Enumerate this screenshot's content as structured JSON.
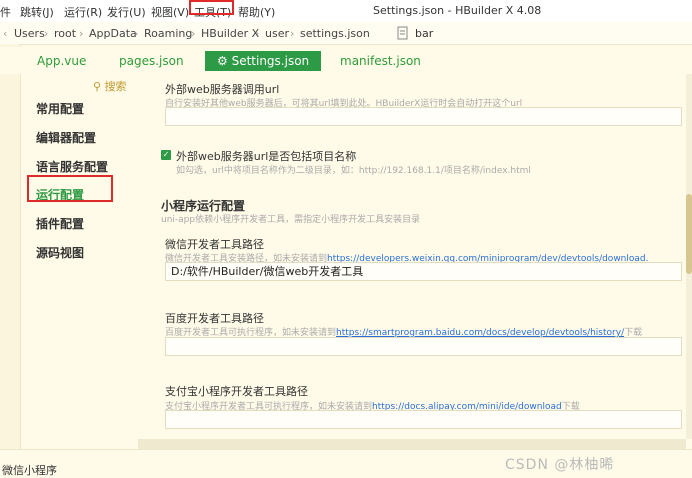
{
  "menubar": {
    "items": [
      "件",
      "跳转(J)",
      "运行(R)",
      "发行(U)",
      "视图(V)",
      "工具(T)",
      "帮助(Y)"
    ],
    "window_title": "Settings.json - HBuilder X 4.08"
  },
  "pathbar": {
    "crumbs": [
      "Users",
      "root",
      "AppData",
      "Roaming",
      "HBuilder X",
      "user",
      "settings.json"
    ],
    "search_value": "bar"
  },
  "tabs": [
    {
      "label": "App.vue"
    },
    {
      "label": "pages.json"
    },
    {
      "label": "⚙ Settings.json"
    },
    {
      "label": "manifest.json"
    }
  ],
  "nav": {
    "search_label": "搜索",
    "items": [
      "常用配置",
      "编辑器配置",
      "语言服务配置",
      "运行配置",
      "插件配置",
      "源码视图"
    ]
  },
  "settings": {
    "ext_server": {
      "label": "外部web服务器调用url",
      "desc": "自行安装好其他web服务器后，可将其url填到此处。HBuilderX运行时会自动打开这个url",
      "value": ""
    },
    "ext_project": {
      "label": "外部web服务器url是否包括项目名称",
      "desc": "如勾选，url中将项目名称作为二级目录，如：http://192.168.1.1/项目名称/index.html"
    },
    "mp_section": {
      "title": "小程序运行配置",
      "desc": "uni-app依赖小程序开发者工具，需指定小程序开发工具安装目录"
    },
    "wechat": {
      "label": "微信开发者工具路径",
      "desc_prefix": "微信开发者工具安装路径，如未安装请到",
      "link": "https://developers.weixin.qq.com/miniprogram/dev/devtools/download.",
      "value": "D:/软件/HBuilder/微信web开发者工具"
    },
    "baidu": {
      "label": "百度开发者工具路径",
      "desc_prefix": "百度开发者工具可执行程序，如未安装请到",
      "link": "https://smartprogram.baidu.com/docs/develop/devtools/history/",
      "desc_suffix": "下载",
      "value": ""
    },
    "alipay": {
      "label": "支付宝小程序开发者工具路径",
      "desc_prefix": "支付宝小程序开发者工具可执行程序，如未安装请到",
      "link": "https://docs.alipay.com/mini/ide/download",
      "desc_suffix": "下载",
      "value": ""
    }
  },
  "bottom": {
    "label": "微信小程序",
    "watermark": "CSDN @林柚晞"
  }
}
